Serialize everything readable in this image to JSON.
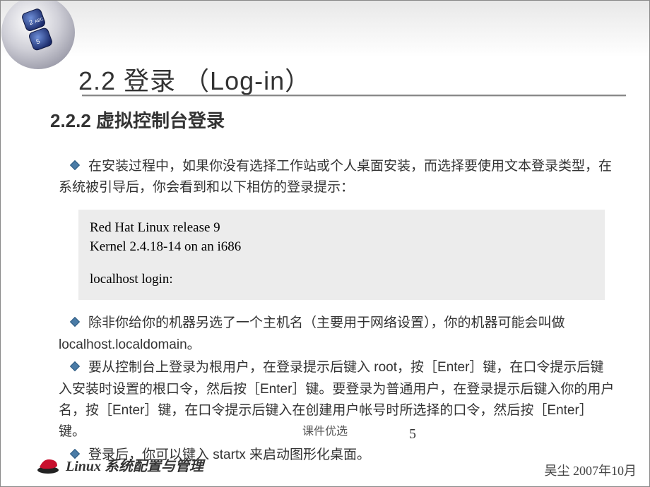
{
  "slide": {
    "title": "2.2 登录 （Log-in）",
    "subtitle": "2.2.2 虚拟控制台登录",
    "bullets": {
      "b1": "在安装过程中，如果你没有选择工作站或个人桌面安装，而选择要使用文本登录类型，在系统被引导后，你会看到和以下相仿的登录提示：",
      "b2": "除非你给你的机器另选了一个主机名（主要用于网络设置），你的机器可能会叫做 localhost.localdomain。",
      "b3": "要从控制台上登录为根用户，在登录提示后键入 root，按［Enter］键，在口令提示后键入安装时设置的根口令，然后按［Enter］键。要登录为普通用户，在登录提示后键入你的用户名，按［Enter］键，在口令提示后键入在创建用户帐号时所选择的口令，然后按［Enter］键。",
      "b4": "登录后，你可以键入 startx 来启动图形化桌面。"
    },
    "code": {
      "l1": "Red Hat Linux release 9",
      "l2": "Kernel 2.4.18-14 on an i686",
      "l3": "localhost login:"
    },
    "footer_center": "课件优选",
    "page_number": "5",
    "footer_left": "Linux 系统配置与管理",
    "footer_right": "吴尘 2007年10月"
  }
}
